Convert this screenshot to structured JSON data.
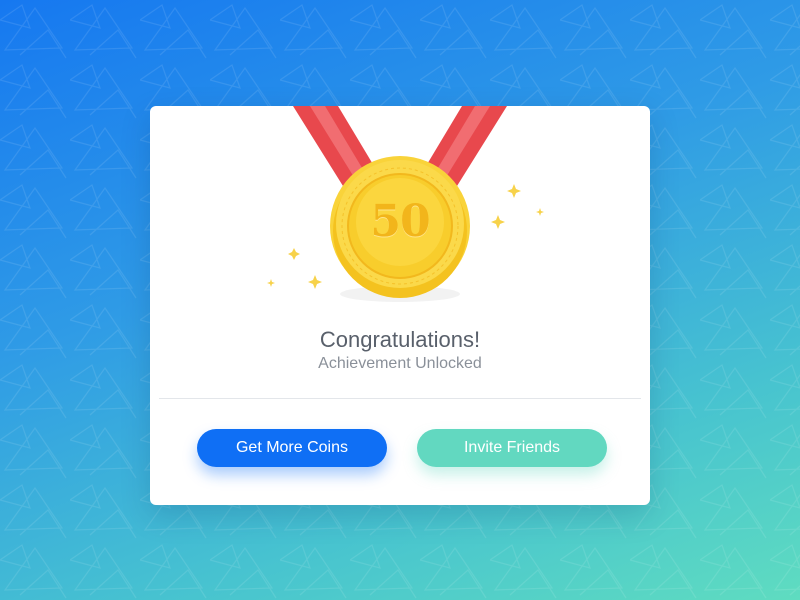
{
  "achievement": {
    "medal_value": "50",
    "title": "Congratulations!",
    "subtitle": "Achievement Unlocked"
  },
  "actions": {
    "primary_label": "Get More Coins",
    "secondary_label": "Invite Friends"
  },
  "colors": {
    "primary_button": "#0f6ff5",
    "secondary_button": "#62d8c0",
    "ribbon": "#e8484d",
    "medal": "#f7cf2a"
  },
  "icons": [
    "medal-icon",
    "sparkle-icon"
  ]
}
